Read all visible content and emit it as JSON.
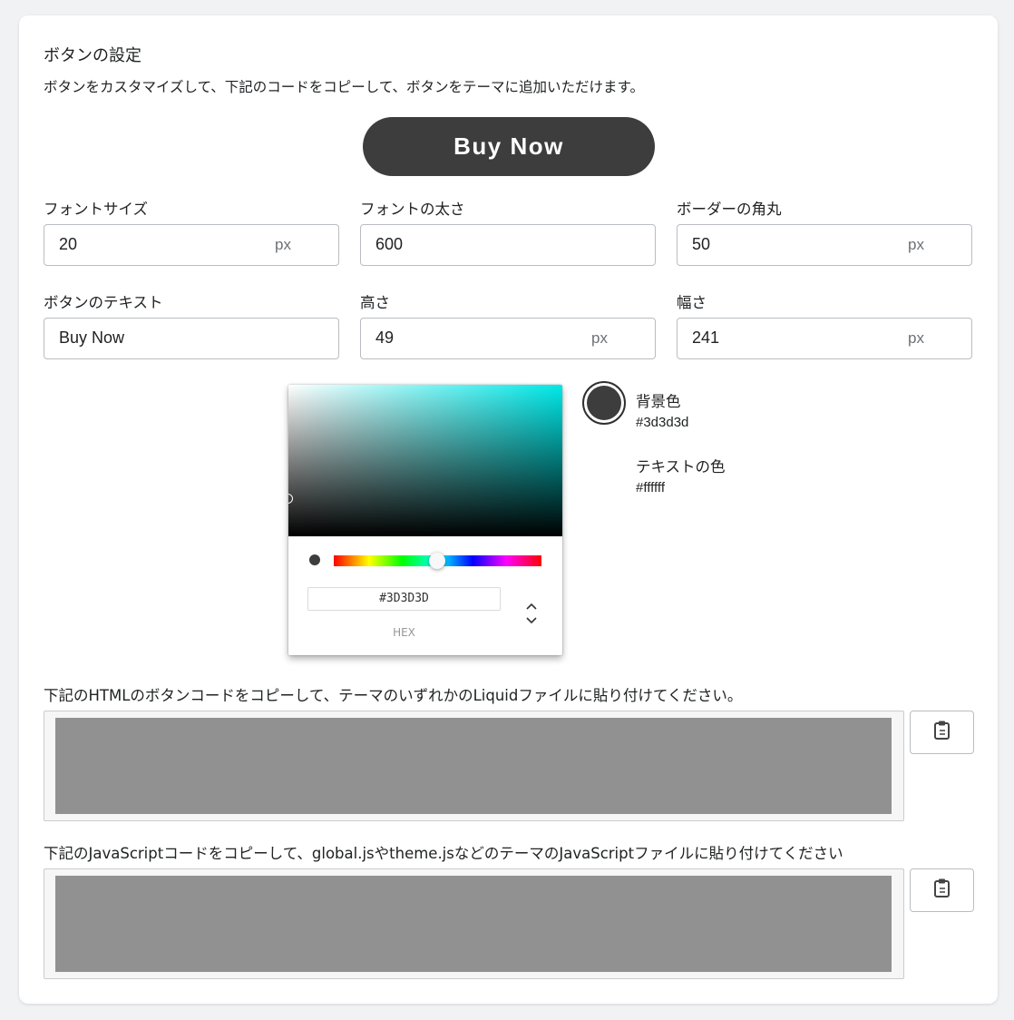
{
  "section": {
    "title": "ボタンの設定",
    "description": "ボタンをカスタマイズして、下記のコードをコピーして、ボタンをテーマに追加いただけます。"
  },
  "preview": {
    "button_text": "Buy Now"
  },
  "fields": {
    "font_size": {
      "label": "フォントサイズ",
      "value": "20",
      "unit": "px"
    },
    "font_weight": {
      "label": "フォントの太さ",
      "value": "600"
    },
    "border_radius": {
      "label": "ボーダーの角丸",
      "value": "50",
      "unit": "px"
    },
    "button_text": {
      "label": "ボタンのテキスト",
      "value": "Buy Now"
    },
    "height": {
      "label": "高さ",
      "value": "49",
      "unit": "px"
    },
    "width": {
      "label": "幅さ",
      "value": "241",
      "unit": "px"
    }
  },
  "color_picker": {
    "hex_value": "#3D3D3D",
    "mode_label": "HEX",
    "hue_color": "#00e8e8"
  },
  "colors": {
    "background": {
      "label": "背景色",
      "value": "#3d3d3d"
    },
    "text": {
      "label": "テキストの色",
      "value": "#ffffff"
    }
  },
  "code": {
    "html": {
      "description": "下記のHTMLのボタンコードをコピーして、テーマのいずれかのLiquidファイルに貼り付けてください。"
    },
    "js": {
      "description": "下記のJavaScriptコードをコピーして、global.jsやtheme.jsなどのテーマのJavaScriptファイルに貼り付けてください"
    }
  },
  "icons": {
    "copy": "clipboard-icon",
    "toggle": "chevron-up-down-icon"
  }
}
